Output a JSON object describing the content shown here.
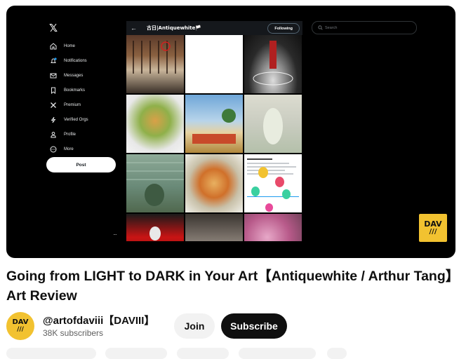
{
  "video": {
    "nav": {
      "x_logo": "𝕏",
      "items": [
        {
          "label": "Home",
          "icon": "home-icon"
        },
        {
          "label": "Notifications",
          "icon": "bell-icon"
        },
        {
          "label": "Messages",
          "icon": "mail-icon"
        },
        {
          "label": "Bookmarks",
          "icon": "bookmark-icon"
        },
        {
          "label": "Premium",
          "icon": "x-premium-icon"
        },
        {
          "label": "Verified Orgs",
          "icon": "lightning-icon"
        },
        {
          "label": "Profile",
          "icon": "person-icon"
        },
        {
          "label": "More",
          "icon": "more-circle-icon"
        }
      ],
      "post_label": "Post",
      "more_dots": "···"
    },
    "feed": {
      "back": "←",
      "title": "古日|Antiquewhite🏳️",
      "follow_label": "Following"
    },
    "search_placeholder": "Search",
    "watermark": {
      "text": "DAV",
      "ticks": "///"
    }
  },
  "title": "Going from LIGHT to DARK in Your Art【Antiquewhite / Arthur Tang】Art Review",
  "channel": {
    "avatar": {
      "text": "DAV",
      "ticks": "///"
    },
    "name": "@artofdaviii【DAVIII】",
    "subscribers": "38K subscribers"
  },
  "buttons": {
    "join": "Join",
    "subscribe": "Subscribe"
  },
  "colors": {
    "brand_yellow": "#f2c230",
    "accent_dark": "#0f0f0f"
  }
}
